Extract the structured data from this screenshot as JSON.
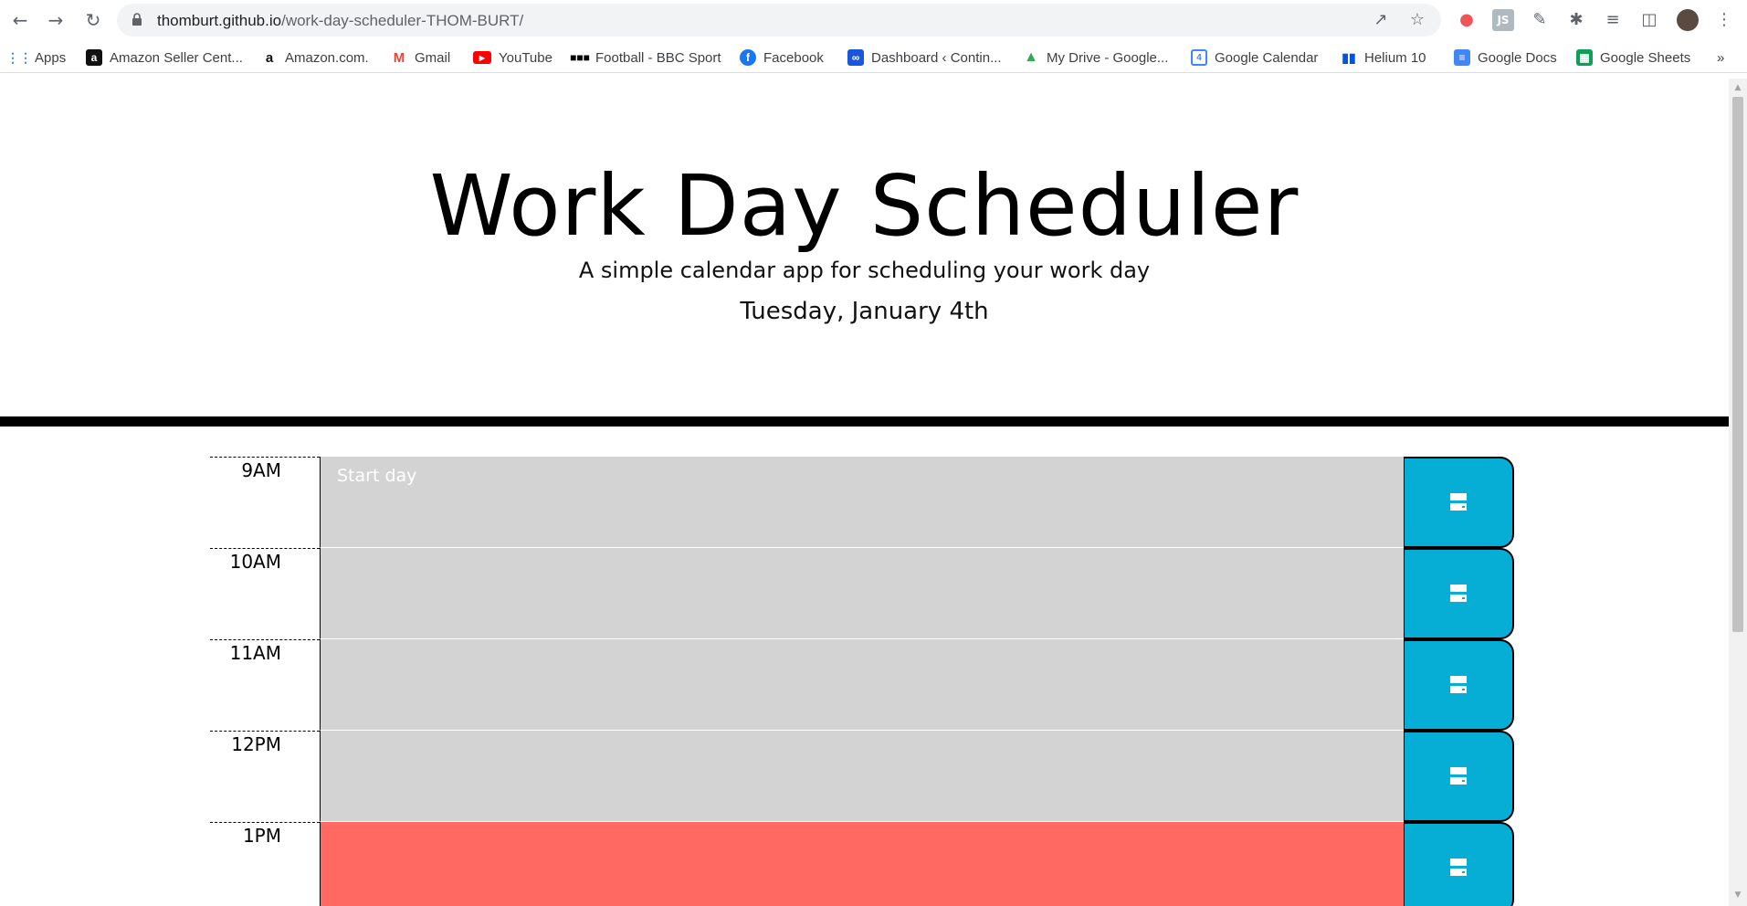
{
  "browser": {
    "url_host": "thomburt.github.io",
    "url_path": "/work-day-scheduler-THOM-BURT/",
    "bookmarks": [
      {
        "label": "Apps",
        "icon": "apps-grid-icon",
        "color": "#4285f4"
      },
      {
        "label": "Amazon Seller Cent...",
        "icon": "amazon-a-icon",
        "color": "#111111"
      },
      {
        "label": "Amazon.com.",
        "icon": "amazon-smile-icon",
        "color": "#ff9900"
      },
      {
        "label": "Gmail",
        "icon": "gmail-icon",
        "color": "#ea4335"
      },
      {
        "label": "YouTube",
        "icon": "youtube-icon",
        "color": "#ff0000"
      },
      {
        "label": "Football - BBC Sport",
        "icon": "bbc-icon",
        "color": "#000000"
      },
      {
        "label": "Facebook",
        "icon": "facebook-icon",
        "color": "#1877f2"
      },
      {
        "label": "Dashboard ‹ Contin...",
        "icon": "infinity-icon",
        "color": "#1a56db"
      },
      {
        "label": "My Drive - Google...",
        "icon": "google-drive-icon",
        "color": "#34a853"
      },
      {
        "label": "Google Calendar",
        "icon": "google-calendar-icon",
        "color": "#4285f4"
      },
      {
        "label": "Helium 10",
        "icon": "helium10-icon",
        "color": "#0055d4"
      },
      {
        "label": "Google Docs",
        "icon": "google-docs-icon",
        "color": "#4285f4"
      },
      {
        "label": "Google Sheets",
        "icon": "google-sheets-icon",
        "color": "#0f9d58"
      }
    ],
    "more_bookmarks": "»"
  },
  "header": {
    "title": "Work Day Scheduler",
    "lead": "A simple calendar app for scheduling your work day",
    "current_day": "Tuesday, January 4th"
  },
  "colors": {
    "past": "#d3d3d3",
    "present": "#ff6961",
    "save": "#06aed5"
  },
  "timeblocks": [
    {
      "hour": "9AM",
      "text": "Start day",
      "state": "past"
    },
    {
      "hour": "10AM",
      "text": "",
      "state": "past"
    },
    {
      "hour": "11AM",
      "text": "",
      "state": "past"
    },
    {
      "hour": "12PM",
      "text": "",
      "state": "past"
    },
    {
      "hour": "1PM",
      "text": "",
      "state": "present"
    }
  ]
}
